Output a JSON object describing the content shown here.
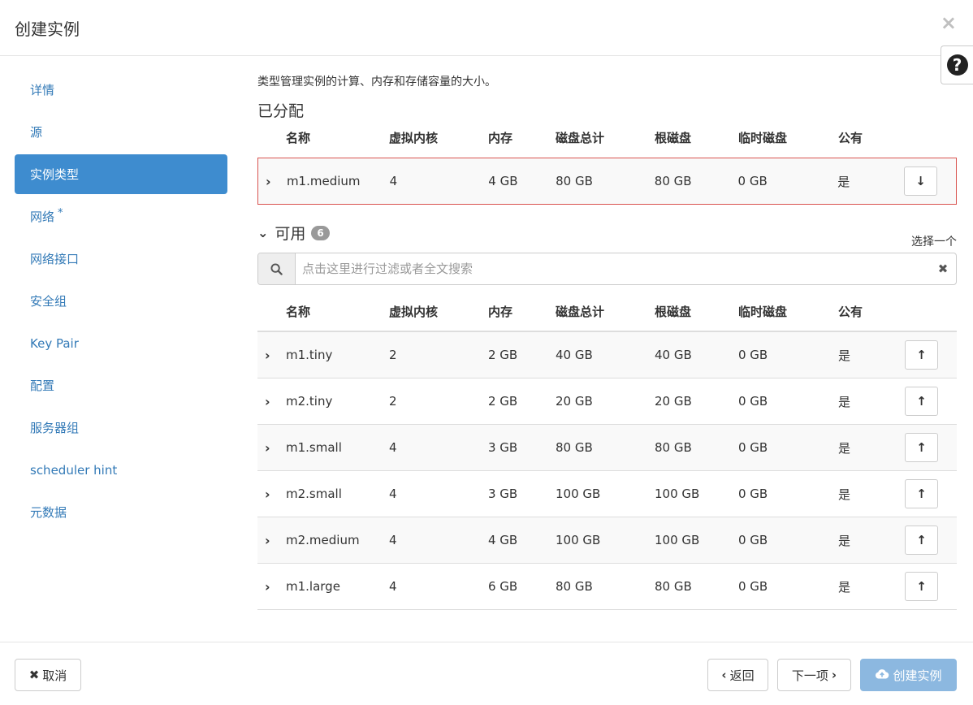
{
  "header": {
    "title": "创建实例",
    "close_icon": "×",
    "help_icon": "?"
  },
  "nav": {
    "items": [
      {
        "label": "详情",
        "active": false
      },
      {
        "label": "源",
        "active": false
      },
      {
        "label": "实例类型",
        "active": true
      },
      {
        "label": "网络",
        "required": "*",
        "active": false
      },
      {
        "label": "网络接口",
        "active": false
      },
      {
        "label": "安全组",
        "active": false
      },
      {
        "label": "Key Pair",
        "active": false
      },
      {
        "label": "配置",
        "active": false
      },
      {
        "label": "服务器组",
        "active": false
      },
      {
        "label": "scheduler hint",
        "active": false
      },
      {
        "label": "元数据",
        "active": false
      }
    ]
  },
  "main": {
    "description": "类型管理实例的计算、内存和存储容量的大小。",
    "allocated_heading": "已分配",
    "columns": [
      "名称",
      "虚拟内核",
      "内存",
      "磁盘总计",
      "根磁盘",
      "临时磁盘",
      "公有"
    ],
    "allocated": [
      {
        "name": "m1.medium",
        "vcpus": "4",
        "ram": "4 GB",
        "disk": "80 GB",
        "root": "80 GB",
        "ephemeral": "0 GB",
        "public": "是"
      }
    ],
    "available_heading": "可用",
    "available_count": "6",
    "pick_one": "选择一个",
    "search_placeholder": "点击这里进行过滤或者全文搜索",
    "available": [
      {
        "name": "m1.tiny",
        "vcpus": "2",
        "ram": "2 GB",
        "disk": "40 GB",
        "root": "40 GB",
        "ephemeral": "0 GB",
        "public": "是"
      },
      {
        "name": "m2.tiny",
        "vcpus": "2",
        "ram": "2 GB",
        "disk": "20 GB",
        "root": "20 GB",
        "ephemeral": "0 GB",
        "public": "是"
      },
      {
        "name": "m1.small",
        "vcpus": "4",
        "ram": "3 GB",
        "disk": "80 GB",
        "root": "80 GB",
        "ephemeral": "0 GB",
        "public": "是"
      },
      {
        "name": "m2.small",
        "vcpus": "4",
        "ram": "3 GB",
        "disk": "100 GB",
        "root": "100 GB",
        "ephemeral": "0 GB",
        "public": "是"
      },
      {
        "name": "m2.medium",
        "vcpus": "4",
        "ram": "4 GB",
        "disk": "100 GB",
        "root": "100 GB",
        "ephemeral": "0 GB",
        "public": "是"
      },
      {
        "name": "m1.large",
        "vcpus": "4",
        "ram": "6 GB",
        "disk": "80 GB",
        "root": "80 GB",
        "ephemeral": "0 GB",
        "public": "是"
      }
    ]
  },
  "footer": {
    "cancel": "取消",
    "back": "返回",
    "next": "下一项",
    "create": "创建实例"
  },
  "colors": {
    "accent": "#3e8ccf",
    "link": "#337ab7",
    "highlight_border": "#d9534f",
    "disabled_primary": "#8cb8e0"
  }
}
